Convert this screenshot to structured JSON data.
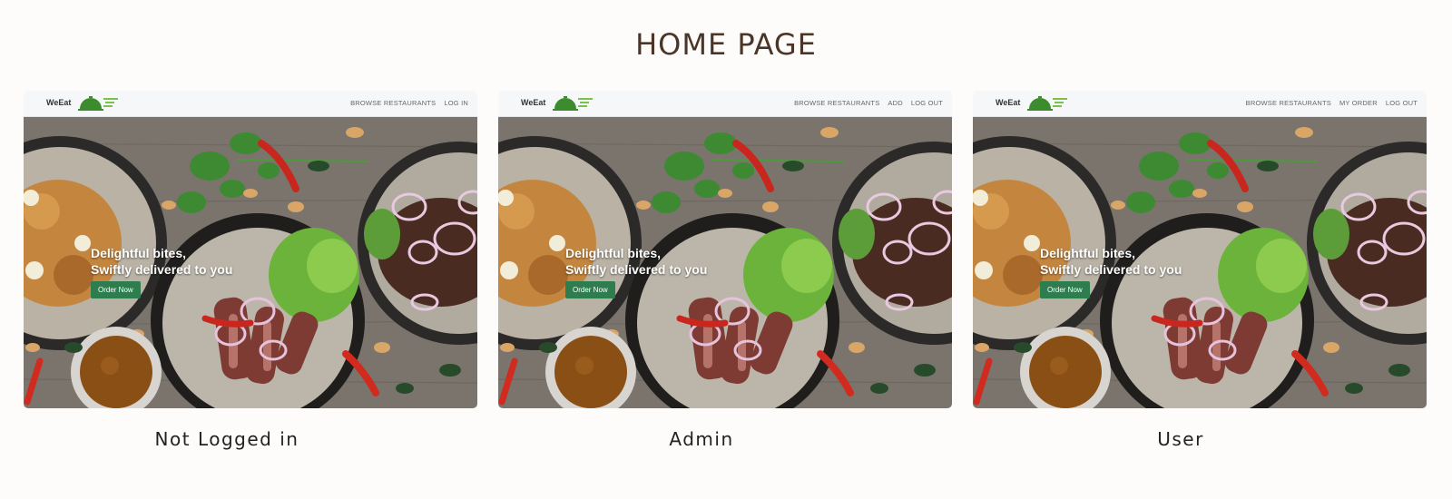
{
  "page_title": "HOME PAGE",
  "brand": {
    "name": "WeEat",
    "accent": "#3c8c2e"
  },
  "hero": {
    "line1": "Delightful bites,",
    "line2": "Swiftly delivered to you",
    "cta": "Order Now",
    "cta_color": "#2e7d4f"
  },
  "screens": [
    {
      "caption": "Not Logged in",
      "nav": [
        "BROWSE RESTAURANTS",
        "LOG IN"
      ]
    },
    {
      "caption": "Admin",
      "nav": [
        "BROWSE RESTAURANTS",
        "ADD",
        "LOG OUT"
      ]
    },
    {
      "caption": "User",
      "nav": [
        "BROWSE RESTAURANTS",
        "MY ORDER",
        "LOG OUT"
      ]
    }
  ]
}
